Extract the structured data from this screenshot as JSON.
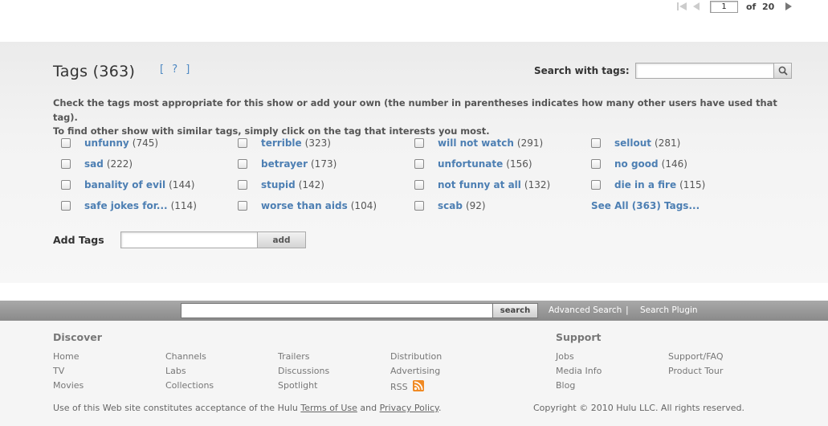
{
  "pager": {
    "current_page": "1",
    "of_label": "of",
    "total_pages": "20"
  },
  "tags": {
    "title": "Tags (363)",
    "help_label": "[ ? ]",
    "search_label": "Search with tags:",
    "search_placeholder": "",
    "instructions_line1": "Check the tags most appropriate for this show or add your own (the number in parentheses indicates how many other users have used that tag).",
    "instructions_line2": "To find other show with similar tags, simply click on the tag that interests you most.",
    "items": [
      {
        "label": "unfunny",
        "count": "(745)"
      },
      {
        "label": "terrible",
        "count": "(323)"
      },
      {
        "label": "will not watch",
        "count": "(291)"
      },
      {
        "label": "sellout",
        "count": "(281)"
      },
      {
        "label": "sad",
        "count": "(222)"
      },
      {
        "label": "betrayer",
        "count": "(173)"
      },
      {
        "label": "unfortunate",
        "count": "(156)"
      },
      {
        "label": "no good",
        "count": "(146)"
      },
      {
        "label": "banality of evil",
        "count": "(144)"
      },
      {
        "label": "stupid",
        "count": "(142)"
      },
      {
        "label": "not funny at all",
        "count": "(132)"
      },
      {
        "label": "die in a fire",
        "count": "(115)"
      },
      {
        "label": "safe jokes for...",
        "count": "(114)"
      },
      {
        "label": "worse than aids",
        "count": "(104)"
      },
      {
        "label": "scab",
        "count": "(92)"
      }
    ],
    "see_all_label": "See All (363) Tags...",
    "add_label": "Add Tags",
    "add_button": "add"
  },
  "footer_search": {
    "button": "search",
    "advanced_link": "Advanced Search",
    "separator": "|",
    "plugin_link": "Search Plugin"
  },
  "footer": {
    "discover_heading": "Discover",
    "support_heading": "Support",
    "discover_col1": [
      "Home",
      "TV",
      "Movies"
    ],
    "discover_col2": [
      "Channels",
      "Labs",
      "Collections"
    ],
    "discover_col3": [
      "Trailers",
      "Discussions",
      "Spotlight"
    ],
    "discover_col4": [
      "Distribution",
      "Advertising",
      "RSS"
    ],
    "support_col1": [
      "Jobs",
      "Media Info",
      "Blog"
    ],
    "support_col2": [
      "Support/FAQ",
      "Product Tour"
    ],
    "legal_prefix": "Use of this Web site constitutes acceptance of the Hulu ",
    "terms_link": "Terms of Use",
    "legal_and": " and ",
    "privacy_link": "Privacy Policy",
    "legal_suffix": ".",
    "copyright": "Copyright © 2010 Hulu LLC. All rights reserved."
  },
  "colors": {
    "link_blue": "#4d7fb3",
    "rss_orange": "#f08a24",
    "footer_bar": "#9a9a9a"
  }
}
